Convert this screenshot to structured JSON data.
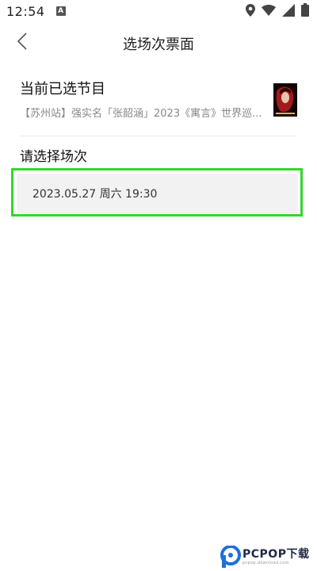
{
  "status_bar": {
    "time": "12:54",
    "notification_letter": "A"
  },
  "header": {
    "title": "选场次票面"
  },
  "program": {
    "heading": "当前已选节目",
    "name": "【苏州站】强实名「张韶涵」2023《寓言》世界巡..."
  },
  "session": {
    "heading": "请选择场次",
    "options": [
      {
        "label": "2023.05.27 周六 19:30",
        "selected": true
      }
    ]
  },
  "watermark": {
    "brand": "PCPOP下载",
    "sub": "pcpop.download.com"
  },
  "colors": {
    "highlight": "#31d82b",
    "card_background": "#f2f2f2",
    "muted_text": "#888888"
  }
}
